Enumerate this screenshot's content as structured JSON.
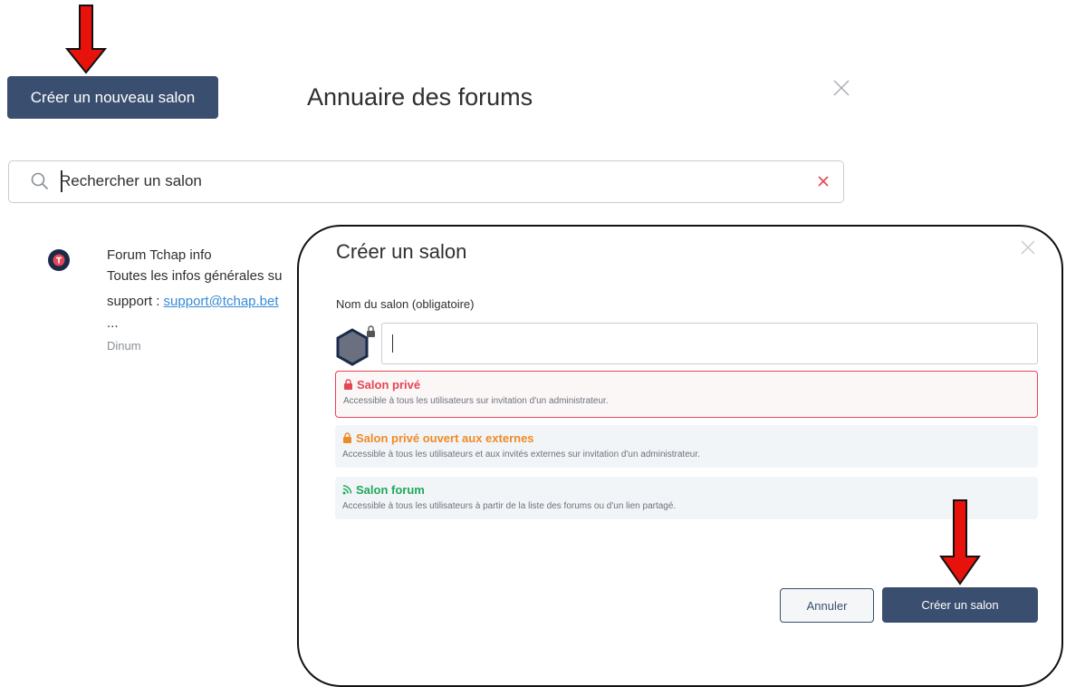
{
  "directory": {
    "create_button": "Créer un nouveau salon",
    "title": "Annuaire des forums",
    "search_placeholder": "Rechercher un salon"
  },
  "forum": {
    "name": "Forum Tchap info",
    "description": "Toutes les infos générales su",
    "support_prefix": "support : ",
    "support_link": "support@tchap.bet",
    "more": "...",
    "organization": "Dinum"
  },
  "modal": {
    "title": "Créer un salon",
    "name_label": "Nom du salon (obligatoire)",
    "options": [
      {
        "title": "Salon privé",
        "description": "Accessible à tous les utilisateurs sur invitation d'un administrateur.",
        "icon": "lock-icon",
        "color": "#e64553",
        "selected": true
      },
      {
        "title": "Salon privé ouvert aux externes",
        "description": "Accessible à tous les utilisateurs et aux invités externes sur invitation d'un administrateur.",
        "icon": "lock-icon",
        "color": "#f08a25",
        "selected": false
      },
      {
        "title": "Salon forum",
        "description": "Accessible à tous les utilisateurs à partir de la liste des forums ou d'un lien partagé.",
        "icon": "rss-icon",
        "color": "#1ea85a",
        "selected": false
      }
    ],
    "cancel_label": "Annuler",
    "submit_label": "Créer un salon"
  },
  "colors": {
    "primary": "#3a4f6f",
    "danger": "#e64553",
    "link": "#368bd6",
    "annotation_arrow": "#e8120c"
  }
}
